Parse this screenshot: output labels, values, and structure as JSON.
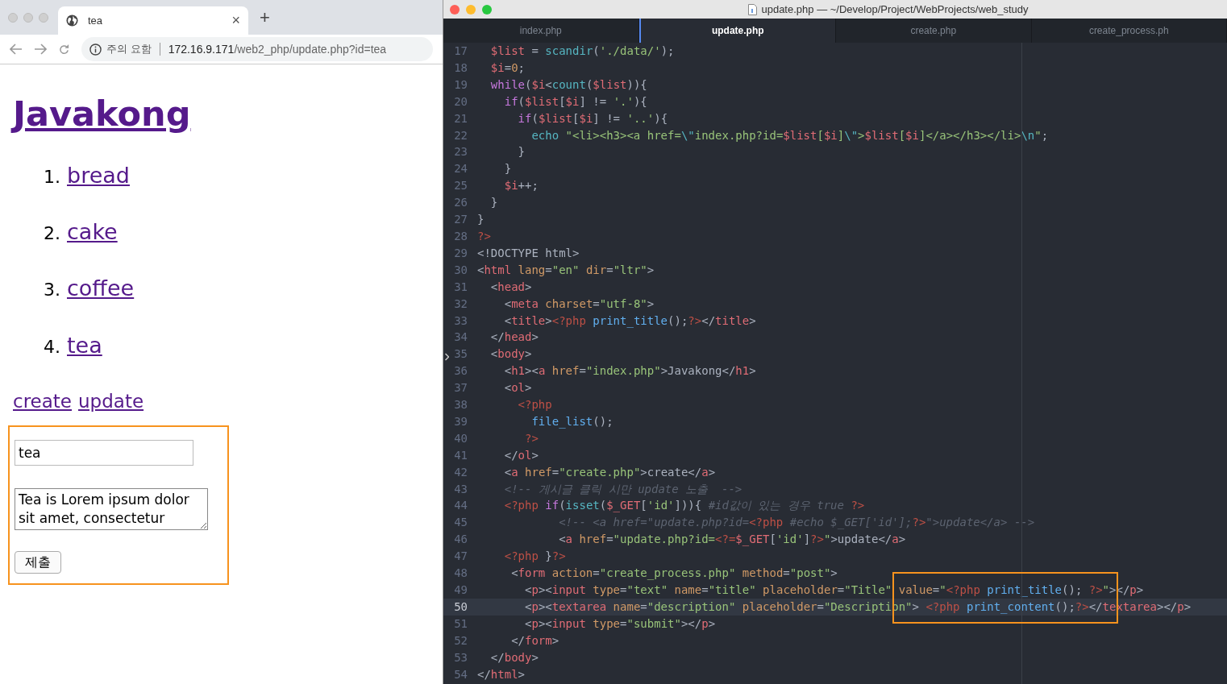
{
  "browser": {
    "tab": {
      "title": "tea",
      "close": "×"
    },
    "new_tab": "+",
    "address_bar": {
      "security_label": "주의 요함",
      "host": "172.16.9.171",
      "path": "/web2_php/update.php?id=tea"
    },
    "page": {
      "heading": "Javakong",
      "items": [
        {
          "number": "1.",
          "label": "bread"
        },
        {
          "number": "2.",
          "label": "cake"
        },
        {
          "number": "3.",
          "label": "coffee"
        },
        {
          "number": "4.",
          "label": "tea"
        }
      ],
      "links": [
        "create",
        "update"
      ],
      "form": {
        "outlined": true,
        "title_value": "tea",
        "description_value": "Tea is Lorem ipsum dolor sit amet, consectetur",
        "submit": "제출"
      }
    }
  },
  "editor": {
    "title": "update.php — ~/Develop/Project/WebProjects/web_study",
    "highlight_box": true,
    "tabs": [
      {
        "label": "index.php",
        "selected": false
      },
      {
        "label": "update.php",
        "selected": true
      },
      {
        "label": "create.php",
        "selected": false
      },
      {
        "label": "create_process.ph",
        "selected": false
      }
    ],
    "lines": [
      {
        "number": "17",
        "current": false,
        "tokens": [
          {
            "kind": "var",
            "text": "  $list"
          },
          {
            "kind": "plain",
            "text": " = "
          },
          {
            "kind": "support",
            "text": "scandir"
          },
          {
            "kind": "plain",
            "text": "("
          },
          {
            "kind": "string",
            "text": "'./data/'"
          },
          {
            "kind": "plain",
            "text": ");"
          }
        ]
      },
      {
        "number": "18",
        "current": false,
        "tokens": [
          {
            "kind": "var",
            "text": "  $i"
          },
          {
            "kind": "plain",
            "text": "="
          },
          {
            "kind": "number",
            "text": "0"
          },
          {
            "kind": "plain",
            "text": ";"
          }
        ]
      },
      {
        "number": "19",
        "current": false,
        "tokens": [
          {
            "kind": "keyword",
            "text": "  while"
          },
          {
            "kind": "plain",
            "text": "("
          },
          {
            "kind": "var",
            "text": "$i"
          },
          {
            "kind": "plain",
            "text": "<"
          },
          {
            "kind": "support",
            "text": "count"
          },
          {
            "kind": "plain",
            "text": "("
          },
          {
            "kind": "var",
            "text": "$list"
          },
          {
            "kind": "plain",
            "text": ")){"
          }
        ]
      },
      {
        "number": "20",
        "current": false,
        "tokens": [
          {
            "kind": "keyword",
            "text": "    if"
          },
          {
            "kind": "plain",
            "text": "("
          },
          {
            "kind": "var",
            "text": "$list"
          },
          {
            "kind": "plain",
            "text": "["
          },
          {
            "kind": "var",
            "text": "$i"
          },
          {
            "kind": "plain",
            "text": "] != "
          },
          {
            "kind": "string",
            "text": "'.'"
          },
          {
            "kind": "plain",
            "text": "){"
          }
        ]
      },
      {
        "number": "21",
        "current": false,
        "tokens": [
          {
            "kind": "keyword",
            "text": "      if"
          },
          {
            "kind": "plain",
            "text": "("
          },
          {
            "kind": "var",
            "text": "$list"
          },
          {
            "kind": "plain",
            "text": "["
          },
          {
            "kind": "var",
            "text": "$i"
          },
          {
            "kind": "plain",
            "text": "] != "
          },
          {
            "kind": "string",
            "text": "'..'"
          },
          {
            "kind": "plain",
            "text": "){"
          }
        ]
      },
      {
        "number": "22",
        "current": false,
        "tokens": [
          {
            "kind": "support",
            "text": "        echo "
          },
          {
            "kind": "string",
            "text": "\"<li><h3><a href="
          },
          {
            "kind": "support",
            "text": "\\\""
          },
          {
            "kind": "string",
            "text": "index.php?id="
          },
          {
            "kind": "var",
            "text": "$list"
          },
          {
            "kind": "string",
            "text": "["
          },
          {
            "kind": "var",
            "text": "$i"
          },
          {
            "kind": "string",
            "text": "]"
          },
          {
            "kind": "support",
            "text": "\\\""
          },
          {
            "kind": "string",
            "text": ">"
          },
          {
            "kind": "var",
            "text": "$list"
          },
          {
            "kind": "string",
            "text": "["
          },
          {
            "kind": "var",
            "text": "$i"
          },
          {
            "kind": "string",
            "text": "]</a></h3></li>"
          },
          {
            "kind": "support",
            "text": "\\n"
          },
          {
            "kind": "string",
            "text": "\""
          },
          {
            "kind": "plain",
            "text": ";"
          }
        ]
      },
      {
        "number": "23",
        "current": false,
        "tokens": [
          {
            "kind": "plain",
            "text": "      }"
          }
        ]
      },
      {
        "number": "24",
        "current": false,
        "tokens": [
          {
            "kind": "plain",
            "text": "    }"
          }
        ]
      },
      {
        "number": "25",
        "current": false,
        "tokens": [
          {
            "kind": "var",
            "text": "    $i"
          },
          {
            "kind": "plain",
            "text": "++;"
          }
        ]
      },
      {
        "number": "26",
        "current": false,
        "tokens": [
          {
            "kind": "plain",
            "text": "  }"
          }
        ]
      },
      {
        "number": "27",
        "current": false,
        "tokens": [
          {
            "kind": "plain",
            "text": "}"
          }
        ]
      },
      {
        "number": "28",
        "current": false,
        "tokens": [
          {
            "kind": "php",
            "text": "?>"
          }
        ]
      },
      {
        "number": "29",
        "current": false,
        "tokens": [
          {
            "kind": "plain",
            "text": "<!DOCTYPE html>"
          }
        ]
      },
      {
        "number": "30",
        "current": false,
        "tokens": [
          {
            "kind": "plain",
            "text": "<"
          },
          {
            "kind": "tag",
            "text": "html"
          },
          {
            "kind": "attr",
            "text": " lang"
          },
          {
            "kind": "plain",
            "text": "="
          },
          {
            "kind": "string",
            "text": "\"en\""
          },
          {
            "kind": "attr",
            "text": " dir"
          },
          {
            "kind": "plain",
            "text": "="
          },
          {
            "kind": "string",
            "text": "\"ltr\""
          },
          {
            "kind": "plain",
            "text": ">"
          }
        ]
      },
      {
        "number": "31",
        "current": false,
        "tokens": [
          {
            "kind": "plain",
            "text": "  <"
          },
          {
            "kind": "tag",
            "text": "head"
          },
          {
            "kind": "plain",
            "text": ">"
          }
        ]
      },
      {
        "number": "32",
        "current": false,
        "tokens": [
          {
            "kind": "plain",
            "text": "    <"
          },
          {
            "kind": "tag",
            "text": "meta"
          },
          {
            "kind": "attr",
            "text": " charset"
          },
          {
            "kind": "plain",
            "text": "="
          },
          {
            "kind": "string",
            "text": "\"utf-8\""
          },
          {
            "kind": "plain",
            "text": ">"
          }
        ]
      },
      {
        "number": "33",
        "current": false,
        "tokens": [
          {
            "kind": "plain",
            "text": "    <"
          },
          {
            "kind": "tag",
            "text": "title"
          },
          {
            "kind": "plain",
            "text": ">"
          },
          {
            "kind": "php",
            "text": "<?php "
          },
          {
            "kind": "func",
            "text": "print_title"
          },
          {
            "kind": "plain",
            "text": "();"
          },
          {
            "kind": "php",
            "text": "?>"
          },
          {
            "kind": "plain",
            "text": "</"
          },
          {
            "kind": "tag",
            "text": "title"
          },
          {
            "kind": "plain",
            "text": ">"
          }
        ]
      },
      {
        "number": "34",
        "current": false,
        "tokens": [
          {
            "kind": "plain",
            "text": "  </"
          },
          {
            "kind": "tag",
            "text": "head"
          },
          {
            "kind": "plain",
            "text": ">"
          }
        ]
      },
      {
        "number": "35",
        "current": false,
        "tokens": [
          {
            "kind": "plain",
            "text": "  <"
          },
          {
            "kind": "tag",
            "text": "body"
          },
          {
            "kind": "plain",
            "text": ">"
          }
        ]
      },
      {
        "number": "36",
        "current": false,
        "tokens": [
          {
            "kind": "plain",
            "text": "    <"
          },
          {
            "kind": "tag",
            "text": "h1"
          },
          {
            "kind": "plain",
            "text": "><"
          },
          {
            "kind": "tag",
            "text": "a"
          },
          {
            "kind": "attr",
            "text": " href"
          },
          {
            "kind": "plain",
            "text": "="
          },
          {
            "kind": "string",
            "text": "\"index.php\""
          },
          {
            "kind": "plain",
            "text": ">Javakong</"
          },
          {
            "kind": "tag",
            "text": "h1"
          },
          {
            "kind": "plain",
            "text": ">"
          }
        ]
      },
      {
        "number": "37",
        "current": false,
        "tokens": [
          {
            "kind": "plain",
            "text": "    <"
          },
          {
            "kind": "tag",
            "text": "ol"
          },
          {
            "kind": "plain",
            "text": ">"
          }
        ]
      },
      {
        "number": "38",
        "current": false,
        "tokens": [
          {
            "kind": "php",
            "text": "      <?php"
          }
        ]
      },
      {
        "number": "39",
        "current": false,
        "tokens": [
          {
            "kind": "func",
            "text": "        file_list"
          },
          {
            "kind": "plain",
            "text": "();"
          }
        ]
      },
      {
        "number": "40",
        "current": false,
        "tokens": [
          {
            "kind": "php",
            "text": "       ?>"
          }
        ]
      },
      {
        "number": "41",
        "current": false,
        "tokens": [
          {
            "kind": "plain",
            "text": "    </"
          },
          {
            "kind": "tag",
            "text": "ol"
          },
          {
            "kind": "plain",
            "text": ">"
          }
        ]
      },
      {
        "number": "42",
        "current": false,
        "tokens": [
          {
            "kind": "plain",
            "text": "    <"
          },
          {
            "kind": "tag",
            "text": "a"
          },
          {
            "kind": "attr",
            "text": " href"
          },
          {
            "kind": "plain",
            "text": "="
          },
          {
            "kind": "string",
            "text": "\"create.php\""
          },
          {
            "kind": "plain",
            "text": ">create</"
          },
          {
            "kind": "tag",
            "text": "a"
          },
          {
            "kind": "plain",
            "text": ">"
          }
        ]
      },
      {
        "number": "43",
        "current": false,
        "tokens": [
          {
            "kind": "comment",
            "text": "    <!-- 게시글 클릭 시만 update 노출  -->"
          }
        ]
      },
      {
        "number": "44",
        "current": false,
        "tokens": [
          {
            "kind": "php",
            "text": "    <?php "
          },
          {
            "kind": "keyword",
            "text": "if"
          },
          {
            "kind": "plain",
            "text": "("
          },
          {
            "kind": "support",
            "text": "isset"
          },
          {
            "kind": "plain",
            "text": "("
          },
          {
            "kind": "var",
            "text": "$_GET"
          },
          {
            "kind": "plain",
            "text": "["
          },
          {
            "kind": "string",
            "text": "'id'"
          },
          {
            "kind": "plain",
            "text": "])){ "
          },
          {
            "kind": "comment",
            "text": "#id값이 있는 경우 true "
          },
          {
            "kind": "php",
            "text": "?>"
          }
        ]
      },
      {
        "number": "45",
        "current": false,
        "tokens": [
          {
            "kind": "comment",
            "text": "            <!-- <a href=\"update.php?id="
          },
          {
            "kind": "php",
            "text": "<?php"
          },
          {
            "kind": "comment",
            "text": " #echo $_GET['id'];"
          },
          {
            "kind": "php",
            "text": "?>"
          },
          {
            "kind": "comment",
            "text": "\">update</a> -->"
          }
        ]
      },
      {
        "number": "46",
        "current": false,
        "tokens": [
          {
            "kind": "plain",
            "text": "            <"
          },
          {
            "kind": "tag",
            "text": "a"
          },
          {
            "kind": "attr",
            "text": " href"
          },
          {
            "kind": "plain",
            "text": "="
          },
          {
            "kind": "string",
            "text": "\"update.php?id="
          },
          {
            "kind": "php",
            "text": "<?="
          },
          {
            "kind": "var",
            "text": "$_GET"
          },
          {
            "kind": "plain",
            "text": "["
          },
          {
            "kind": "string",
            "text": "'id'"
          },
          {
            "kind": "plain",
            "text": "]"
          },
          {
            "kind": "php",
            "text": "?>"
          },
          {
            "kind": "string",
            "text": "\""
          },
          {
            "kind": "plain",
            "text": ">update</"
          },
          {
            "kind": "tag",
            "text": "a"
          },
          {
            "kind": "plain",
            "text": ">"
          }
        ]
      },
      {
        "number": "47",
        "current": false,
        "tokens": [
          {
            "kind": "php",
            "text": "    <?php"
          },
          {
            "kind": "plain",
            "text": " }"
          },
          {
            "kind": "php",
            "text": "?>"
          }
        ]
      },
      {
        "number": "48",
        "current": false,
        "tokens": [
          {
            "kind": "plain",
            "text": "     <"
          },
          {
            "kind": "tag",
            "text": "form"
          },
          {
            "kind": "attr",
            "text": " action"
          },
          {
            "kind": "plain",
            "text": "="
          },
          {
            "kind": "string",
            "text": "\"create_process.php\""
          },
          {
            "kind": "attr",
            "text": " method"
          },
          {
            "kind": "plain",
            "text": "="
          },
          {
            "kind": "string",
            "text": "\"post\""
          },
          {
            "kind": "plain",
            "text": ">"
          }
        ]
      },
      {
        "number": "49",
        "current": false,
        "tokens": [
          {
            "kind": "plain",
            "text": "       <"
          },
          {
            "kind": "tag",
            "text": "p"
          },
          {
            "kind": "plain",
            "text": "><"
          },
          {
            "kind": "tag",
            "text": "input"
          },
          {
            "kind": "attr",
            "text": " type"
          },
          {
            "kind": "plain",
            "text": "="
          },
          {
            "kind": "string",
            "text": "\"text\""
          },
          {
            "kind": "attr",
            "text": " name"
          },
          {
            "kind": "plain",
            "text": "="
          },
          {
            "kind": "string",
            "text": "\"title\""
          },
          {
            "kind": "attr",
            "text": " placeholder"
          },
          {
            "kind": "plain",
            "text": "="
          },
          {
            "kind": "string",
            "text": "\"Title\""
          },
          {
            "kind": "attr",
            "text": " value"
          },
          {
            "kind": "plain",
            "text": "="
          },
          {
            "kind": "string",
            "text": "\""
          },
          {
            "kind": "php",
            "text": "<?php "
          },
          {
            "kind": "func",
            "text": "print_title"
          },
          {
            "kind": "plain",
            "text": "(); "
          },
          {
            "kind": "php",
            "text": "?>"
          },
          {
            "kind": "string",
            "text": "\""
          },
          {
            "kind": "plain",
            "text": "></"
          },
          {
            "kind": "tag",
            "text": "p"
          },
          {
            "kind": "plain",
            "text": ">"
          }
        ]
      },
      {
        "number": "50",
        "current": true,
        "tokens": [
          {
            "kind": "plain",
            "text": "       <"
          },
          {
            "kind": "tag",
            "text": "p"
          },
          {
            "kind": "plain",
            "text": "><"
          },
          {
            "kind": "tag",
            "text": "textarea"
          },
          {
            "kind": "attr",
            "text": " name"
          },
          {
            "kind": "plain",
            "text": "="
          },
          {
            "kind": "string",
            "text": "\"description\""
          },
          {
            "kind": "attr",
            "text": " placeholder"
          },
          {
            "kind": "plain",
            "text": "="
          },
          {
            "kind": "string",
            "text": "\"Description\""
          },
          {
            "kind": "plain",
            "text": "> "
          },
          {
            "kind": "php",
            "text": "<?php "
          },
          {
            "kind": "func",
            "text": "print_content"
          },
          {
            "kind": "plain",
            "text": "();"
          },
          {
            "kind": "php",
            "text": "?>"
          },
          {
            "kind": "plain",
            "text": "</"
          },
          {
            "kind": "tag",
            "text": "textarea"
          },
          {
            "kind": "plain",
            "text": "></"
          },
          {
            "kind": "tag",
            "text": "p"
          },
          {
            "kind": "plain",
            "text": ">"
          }
        ]
      },
      {
        "number": "51",
        "current": false,
        "tokens": [
          {
            "kind": "plain",
            "text": "       <"
          },
          {
            "kind": "tag",
            "text": "p"
          },
          {
            "kind": "plain",
            "text": "><"
          },
          {
            "kind": "tag",
            "text": "input"
          },
          {
            "kind": "attr",
            "text": " type"
          },
          {
            "kind": "plain",
            "text": "="
          },
          {
            "kind": "string",
            "text": "\"submit\""
          },
          {
            "kind": "plain",
            "text": "></"
          },
          {
            "kind": "tag",
            "text": "p"
          },
          {
            "kind": "plain",
            "text": ">"
          }
        ]
      },
      {
        "number": "52",
        "current": false,
        "tokens": [
          {
            "kind": "plain",
            "text": "     </"
          },
          {
            "kind": "tag",
            "text": "form"
          },
          {
            "kind": "plain",
            "text": ">"
          }
        ]
      },
      {
        "number": "53",
        "current": false,
        "tokens": [
          {
            "kind": "plain",
            "text": "  </"
          },
          {
            "kind": "tag",
            "text": "body"
          },
          {
            "kind": "plain",
            "text": ">"
          }
        ]
      },
      {
        "number": "54",
        "current": false,
        "tokens": [
          {
            "kind": "plain",
            "text": "</"
          },
          {
            "kind": "tag",
            "text": "html"
          },
          {
            "kind": "plain",
            "text": ">"
          }
        ]
      }
    ]
  }
}
